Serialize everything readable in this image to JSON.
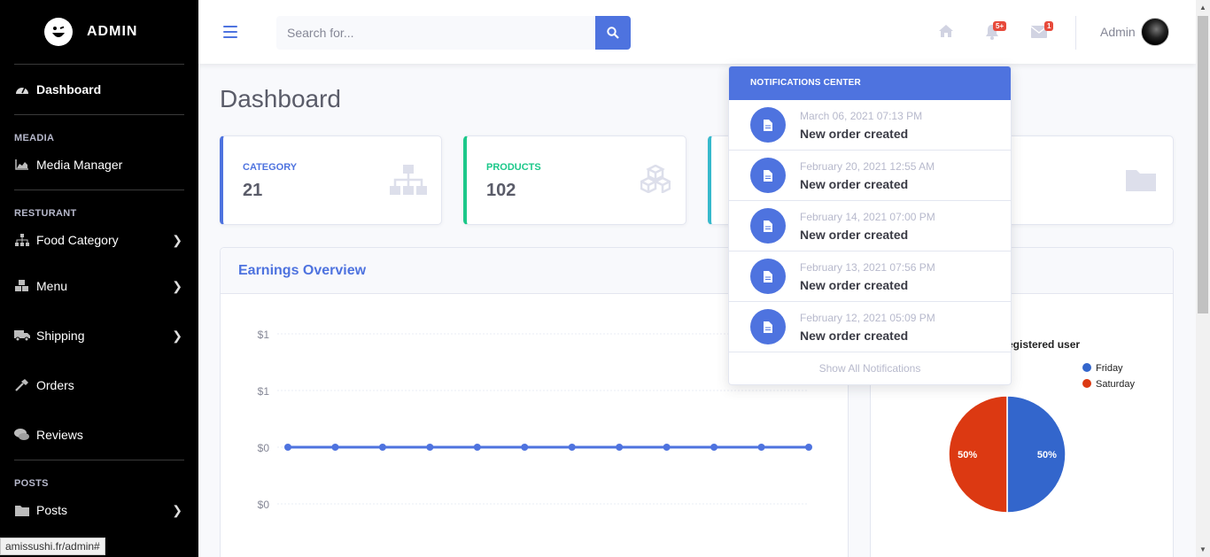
{
  "sidebar": {
    "brand": "ADMIN",
    "dashboard": "Dashboard",
    "sections": [
      {
        "heading": "MEADIA"
      },
      {
        "heading": "RESTURANT"
      },
      {
        "heading": "POSTS"
      }
    ],
    "items": [
      {
        "label": "Media Manager",
        "icon": "chart-area-icon"
      },
      {
        "label": "Food Category",
        "icon": "sitemap-icon"
      },
      {
        "label": "Menu",
        "icon": "cubes-icon"
      },
      {
        "label": "Shipping",
        "icon": "truck-icon"
      },
      {
        "label": "Orders",
        "icon": "hammer-icon"
      },
      {
        "label": "Reviews",
        "icon": "comments-icon"
      },
      {
        "label": "Posts",
        "icon": "folder-icon"
      }
    ]
  },
  "status_url": "amissushi.fr/admin#",
  "topbar": {
    "search_placeholder": "Search for...",
    "alerts_badge": "5+",
    "messages_badge": "1",
    "user_name": "Admin"
  },
  "page_title": "Dashboard",
  "cards": [
    {
      "title": "CATEGORY",
      "value": "21",
      "color": "#4e73df"
    },
    {
      "title": "PRODUCTS",
      "value": "102",
      "color": "#1cc88a"
    }
  ],
  "earnings": {
    "title": "Earnings Overview"
  },
  "chart_data": [
    {
      "type": "line",
      "y_tick_labels": [
        "$1",
        "$1",
        "$0",
        "$0"
      ],
      "series": [
        {
          "values": [
            0,
            0,
            0,
            0,
            0,
            0,
            0,
            0,
            0,
            0,
            0,
            0
          ]
        }
      ],
      "color": "#4e73df"
    },
    {
      "type": "pie",
      "title": "egistered user",
      "legend": [
        "Friday",
        "Saturday"
      ],
      "values": [
        50,
        50
      ],
      "labels": [
        "50%",
        "50%"
      ],
      "colors": [
        "#3366cc",
        "#dc3912"
      ]
    }
  ],
  "notifications": {
    "header": "NOTIFICATIONS CENTER",
    "items": [
      {
        "date": "March 06, 2021 07:13 PM",
        "text": "New order created"
      },
      {
        "date": "February 20, 2021 12:55 AM",
        "text": "New order created"
      },
      {
        "date": "February 14, 2021 07:00 PM",
        "text": "New order created"
      },
      {
        "date": "February 13, 2021 07:56 PM",
        "text": "New order created"
      },
      {
        "date": "February 12, 2021 05:09 PM",
        "text": "New order created"
      }
    ],
    "footer": "Show All Notifications"
  }
}
